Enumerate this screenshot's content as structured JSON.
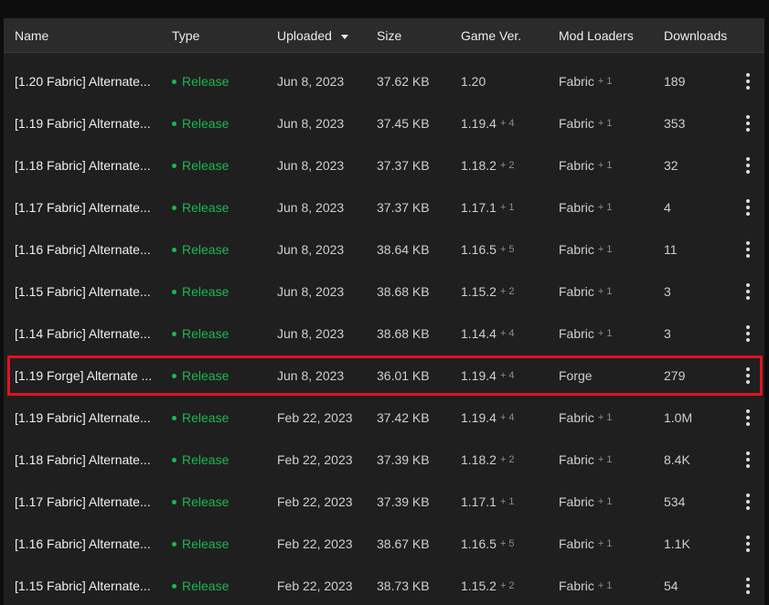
{
  "columns": {
    "name": "Name",
    "type": "Type",
    "uploaded": "Uploaded",
    "size": "Size",
    "game_version": "Game Ver.",
    "mod_loaders": "Mod Loaders",
    "downloads": "Downloads"
  },
  "sort_icon": "caret-down-icon",
  "status_color": "#1bb84f",
  "highlight_color": "#e0121e",
  "highlighted_row": 7,
  "rows": [
    {
      "name": "[1.20 Fabric] Alternate...",
      "type": "Release",
      "uploaded": "Jun 8, 2023",
      "size": "37.62 KB",
      "game_version": "1.20",
      "game_version_extra": "",
      "loader": "Fabric",
      "loader_extra": "+ 1",
      "downloads": "189"
    },
    {
      "name": "[1.19 Fabric] Alternate...",
      "type": "Release",
      "uploaded": "Jun 8, 2023",
      "size": "37.45 KB",
      "game_version": "1.19.4",
      "game_version_extra": "+ 4",
      "loader": "Fabric",
      "loader_extra": "+ 1",
      "downloads": "353"
    },
    {
      "name": "[1.18 Fabric] Alternate...",
      "type": "Release",
      "uploaded": "Jun 8, 2023",
      "size": "37.37 KB",
      "game_version": "1.18.2",
      "game_version_extra": "+ 2",
      "loader": "Fabric",
      "loader_extra": "+ 1",
      "downloads": "32"
    },
    {
      "name": "[1.17 Fabric] Alternate...",
      "type": "Release",
      "uploaded": "Jun 8, 2023",
      "size": "37.37 KB",
      "game_version": "1.17.1",
      "game_version_extra": "+ 1",
      "loader": "Fabric",
      "loader_extra": "+ 1",
      "downloads": "4"
    },
    {
      "name": "[1.16 Fabric] Alternate...",
      "type": "Release",
      "uploaded": "Jun 8, 2023",
      "size": "38.64 KB",
      "game_version": "1.16.5",
      "game_version_extra": "+ 5",
      "loader": "Fabric",
      "loader_extra": "+ 1",
      "downloads": "11"
    },
    {
      "name": "[1.15 Fabric] Alternate...",
      "type": "Release",
      "uploaded": "Jun 8, 2023",
      "size": "38.68 KB",
      "game_version": "1.15.2",
      "game_version_extra": "+ 2",
      "loader": "Fabric",
      "loader_extra": "+ 1",
      "downloads": "3"
    },
    {
      "name": "[1.14 Fabric] Alternate...",
      "type": "Release",
      "uploaded": "Jun 8, 2023",
      "size": "38.68 KB",
      "game_version": "1.14.4",
      "game_version_extra": "+ 4",
      "loader": "Fabric",
      "loader_extra": "+ 1",
      "downloads": "3"
    },
    {
      "name": "[1.19 Forge] Alternate ...",
      "type": "Release",
      "uploaded": "Jun 8, 2023",
      "size": "36.01 KB",
      "game_version": "1.19.4",
      "game_version_extra": "+ 4",
      "loader": "Forge",
      "loader_extra": "",
      "downloads": "279"
    },
    {
      "name": "[1.19 Fabric] Alternate...",
      "type": "Release",
      "uploaded": "Feb 22, 2023",
      "size": "37.42 KB",
      "game_version": "1.19.4",
      "game_version_extra": "+ 4",
      "loader": "Fabric",
      "loader_extra": "+ 1",
      "downloads": "1.0M"
    },
    {
      "name": "[1.18 Fabric] Alternate...",
      "type": "Release",
      "uploaded": "Feb 22, 2023",
      "size": "37.39 KB",
      "game_version": "1.18.2",
      "game_version_extra": "+ 2",
      "loader": "Fabric",
      "loader_extra": "+ 1",
      "downloads": "8.4K"
    },
    {
      "name": "[1.17 Fabric] Alternate...",
      "type": "Release",
      "uploaded": "Feb 22, 2023",
      "size": "37.39 KB",
      "game_version": "1.17.1",
      "game_version_extra": "+ 1",
      "loader": "Fabric",
      "loader_extra": "+ 1",
      "downloads": "534"
    },
    {
      "name": "[1.16 Fabric] Alternate...",
      "type": "Release",
      "uploaded": "Feb 22, 2023",
      "size": "38.67 KB",
      "game_version": "1.16.5",
      "game_version_extra": "+ 5",
      "loader": "Fabric",
      "loader_extra": "+ 1",
      "downloads": "1.1K"
    },
    {
      "name": "[1.15 Fabric] Alternate...",
      "type": "Release",
      "uploaded": "Feb 22, 2023",
      "size": "38.73 KB",
      "game_version": "1.15.2",
      "game_version_extra": "+ 2",
      "loader": "Fabric",
      "loader_extra": "+ 1",
      "downloads": "54"
    }
  ]
}
